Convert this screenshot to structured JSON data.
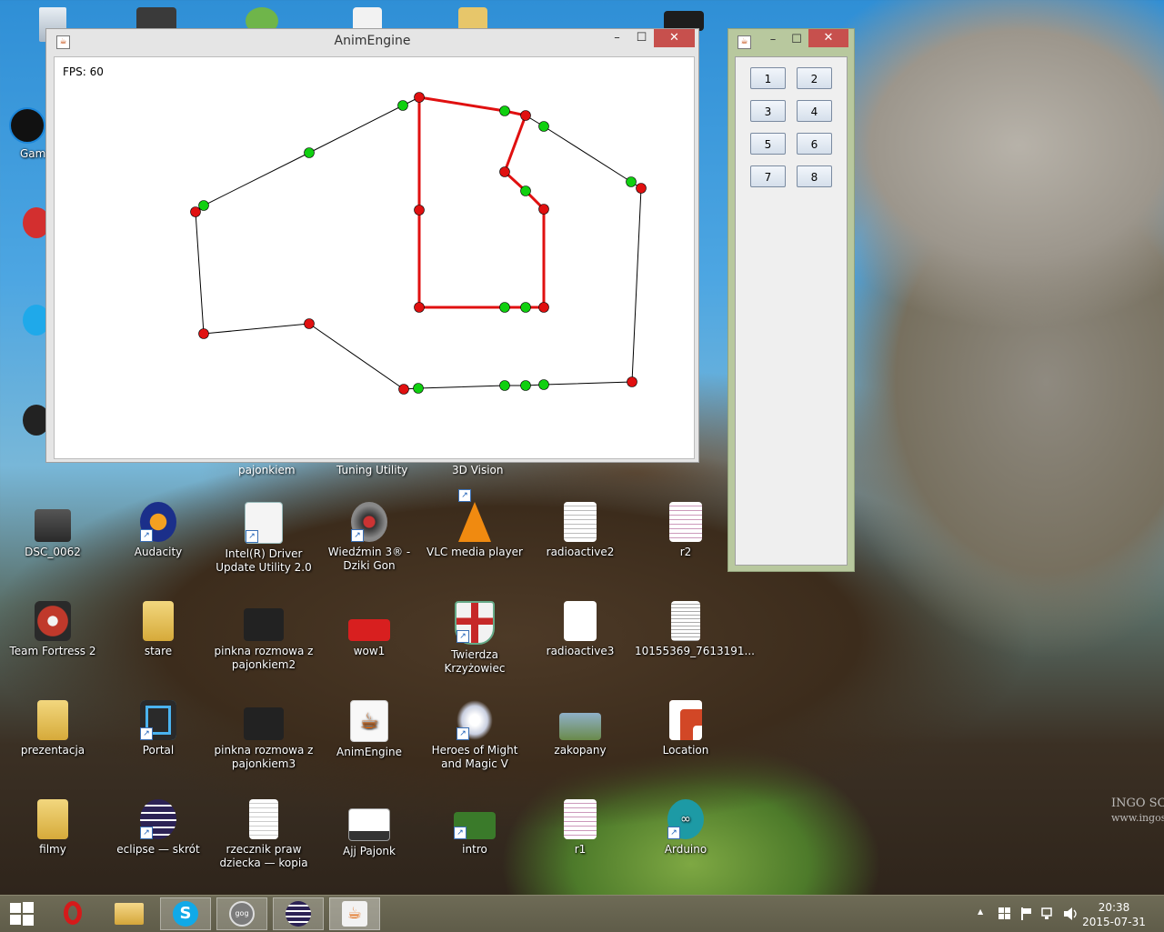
{
  "main_window": {
    "title": "AnimEngine",
    "minimize": "–",
    "maximize": "☐",
    "close": "✕",
    "fps_label": "FPS: 60"
  },
  "buttons_window": {
    "minimize": "–",
    "maximize": "☐",
    "close": "✕",
    "buttons": [
      "1",
      "2",
      "3",
      "4",
      "5",
      "6",
      "7",
      "8"
    ]
  },
  "scene": {
    "outer_color": "#000000",
    "path_color": "#e01010",
    "red_point_color": "#e01010",
    "green_point_color": "#10d010"
  },
  "partial_labels": {
    "pajonkiem": "pajonkiem",
    "tuning": "Tuning Utility",
    "vision": "3D Vision",
    "gam": "Gam",
    "watermark": "INGO SC",
    "watermark_url": "www.ingosc"
  },
  "desktop_icons": {
    "dsc": "DSC_0062",
    "audacity": "Audacity",
    "intel": "Intel(R) Driver Update Utility 2.0",
    "wiedzmin": "Wiedźmin 3® - Dziki Gon",
    "vlc": "VLC media player",
    "radioactive2": "radioactive2",
    "r2": "r2",
    "tf2": "Team Fortress 2",
    "stare": "stare",
    "pinkna2": "pinkna rozmowa z pajonkiem2",
    "wow1": "wow1",
    "twierdza": "Twierdza Krzyżowiec",
    "radioactive3": "radioactive3",
    "file1015": "10155369_7613191...",
    "prezentacja": "prezentacja",
    "portal": "Portal",
    "pinkna3": "pinkna rozmowa z pajonkiem3",
    "animengine": "AnimEngine",
    "heroes": "Heroes of Might and Magic V",
    "zakopany": "zakopany",
    "location": "Location",
    "filmy": "filmy",
    "eclipse": "eclipse — skrót",
    "rzecznik": "rzecznik praw dziecka — kopia",
    "ajj": "Ajj Pajonk",
    "intro": "intro",
    "r1": "r1",
    "arduino": "Arduino"
  },
  "taskbar": {
    "time": "20:38",
    "date": "2015-07-31",
    "up_arrow": "▲"
  }
}
